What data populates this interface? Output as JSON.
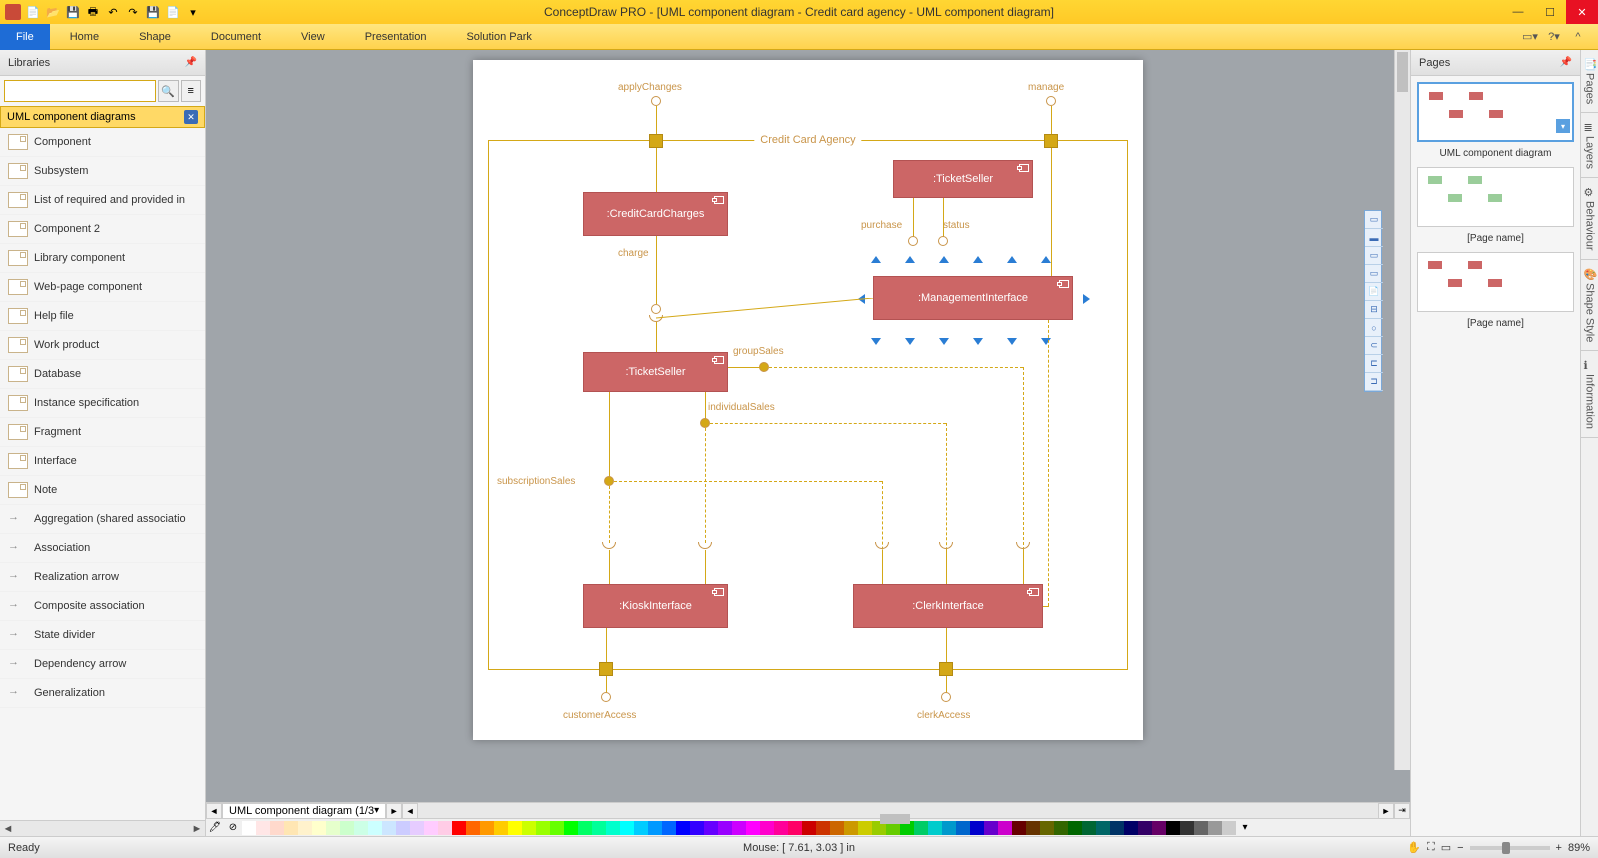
{
  "titlebar": {
    "title": "ConceptDraw PRO - [UML component diagram - Credit card agency - UML component diagram]"
  },
  "ribbon": {
    "file": "File",
    "tabs": [
      "Home",
      "Shape",
      "Document",
      "View",
      "Presentation",
      "Solution Park"
    ]
  },
  "libraries": {
    "header": "Libraries",
    "category": "UML component diagrams",
    "items": [
      {
        "label": "Component",
        "icon": "box"
      },
      {
        "label": "Subsystem",
        "icon": "box"
      },
      {
        "label": "List of required and provided in",
        "icon": "box"
      },
      {
        "label": "Component 2",
        "icon": "box"
      },
      {
        "label": "Library component",
        "icon": "box"
      },
      {
        "label": "Web-page component",
        "icon": "box"
      },
      {
        "label": "Help file",
        "icon": "box"
      },
      {
        "label": "Work product",
        "icon": "box"
      },
      {
        "label": "Database",
        "icon": "box"
      },
      {
        "label": "Instance specification",
        "icon": "box"
      },
      {
        "label": "Fragment",
        "icon": "box"
      },
      {
        "label": "Interface",
        "icon": "box"
      },
      {
        "label": "Note",
        "icon": "box"
      },
      {
        "label": "Aggregation (shared associatio",
        "icon": "arrow"
      },
      {
        "label": "Association",
        "icon": "arrow"
      },
      {
        "label": "Realization arrow",
        "icon": "arrow"
      },
      {
        "label": "Composite association",
        "icon": "arrow"
      },
      {
        "label": "State divider",
        "icon": "arrow"
      },
      {
        "label": "Dependency arrow",
        "icon": "arrow"
      },
      {
        "label": "Generalization",
        "icon": "arrow"
      }
    ]
  },
  "diagram": {
    "frame_title": "Credit Card Agency",
    "labels": {
      "applyChanges": "applyChanges",
      "manage": "manage",
      "purchase": "purchase",
      "status": "status",
      "charge": "charge",
      "groupSales": "groupSales",
      "individualSales": "individualSales",
      "subscriptionSales": "subscriptionSales",
      "customerAccess": "customerAccess",
      "clerkAccess": "clerkAccess"
    },
    "components": {
      "creditCardCharges": ":CreditCardCharges",
      "ticketSeller1": ":TicketSeller",
      "managementInterface": ":ManagementInterface",
      "ticketSeller2": ":TicketSeller",
      "kioskInterface": ":KioskInterface",
      "clerkInterface": ":ClerkInterface"
    }
  },
  "sheet_tab": "UML component diagram (1/3",
  "pages": {
    "header": "Pages",
    "items": [
      {
        "name": "UML component diagram",
        "active": true
      },
      {
        "name": "[Page name]",
        "active": false
      },
      {
        "name": "[Page name]",
        "active": false
      }
    ]
  },
  "side_tabs": [
    "Pages",
    "Layers",
    "Behaviour",
    "Shape Style",
    "Information"
  ],
  "status": {
    "ready": "Ready",
    "mouse": "Mouse: [ 7.61, 3.03 ] in",
    "zoom": "89%"
  },
  "colors": [
    "#ffffff",
    "#ffe6e6",
    "#ffd9cc",
    "#ffe6b3",
    "#fff2cc",
    "#ffffcc",
    "#e6ffcc",
    "#ccffcc",
    "#ccffe6",
    "#ccffff",
    "#cce6ff",
    "#ccccff",
    "#e6ccff",
    "#ffccff",
    "#ffcce6",
    "#ff0000",
    "#ff6600",
    "#ff9900",
    "#ffcc00",
    "#ffff00",
    "#ccff00",
    "#99ff00",
    "#66ff00",
    "#00ff00",
    "#00ff66",
    "#00ff99",
    "#00ffcc",
    "#00ffff",
    "#00ccff",
    "#0099ff",
    "#0066ff",
    "#0000ff",
    "#3300ff",
    "#6600ff",
    "#9900ff",
    "#cc00ff",
    "#ff00ff",
    "#ff00cc",
    "#ff0099",
    "#ff0066",
    "#cc0000",
    "#cc3300",
    "#cc6600",
    "#cc9900",
    "#cccc00",
    "#99cc00",
    "#66cc00",
    "#00cc00",
    "#00cc66",
    "#00cccc",
    "#0099cc",
    "#0066cc",
    "#0000cc",
    "#6600cc",
    "#cc00cc",
    "#660000",
    "#663300",
    "#666600",
    "#336600",
    "#006600",
    "#006633",
    "#006666",
    "#003366",
    "#000066",
    "#330066",
    "#660066",
    "#000000",
    "#333333",
    "#666666",
    "#999999",
    "#cccccc"
  ]
}
